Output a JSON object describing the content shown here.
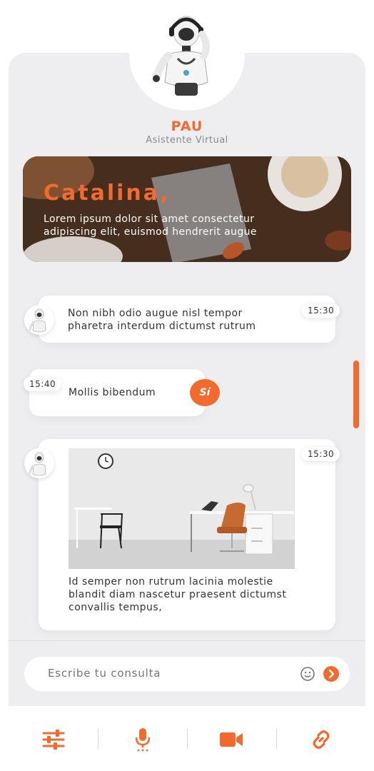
{
  "assistant": {
    "name": "PAU",
    "role": "Asistente Virtual"
  },
  "banner": {
    "user_name": "Catalina,",
    "text": "Lorem ipsum dolor sit amet consectetur adipiscing elit, euismod hendrerit augue"
  },
  "messages": [
    {
      "sender": "bot",
      "text": "Non nibh odio augue nisl tempor pharetra interdum dictumst rutrum",
      "time": "15:30"
    },
    {
      "sender": "user",
      "text": "Mollis bibendum",
      "time": "15:40",
      "badge": "Sí"
    },
    {
      "sender": "bot",
      "text": "Id semper non rutrum lacinia molestie blandit diam nascetur praesent dictumst convallis tempus,",
      "time": "15:30"
    }
  ],
  "composer": {
    "placeholder": "Escribe tu consulta"
  },
  "toolbar": {
    "items": [
      "sliders-icon",
      "microphone-icon",
      "video-camera-icon",
      "link-icon"
    ]
  },
  "colors": {
    "accent": "#f26a2e",
    "panel": "#eeeef1",
    "text": "#333333"
  }
}
